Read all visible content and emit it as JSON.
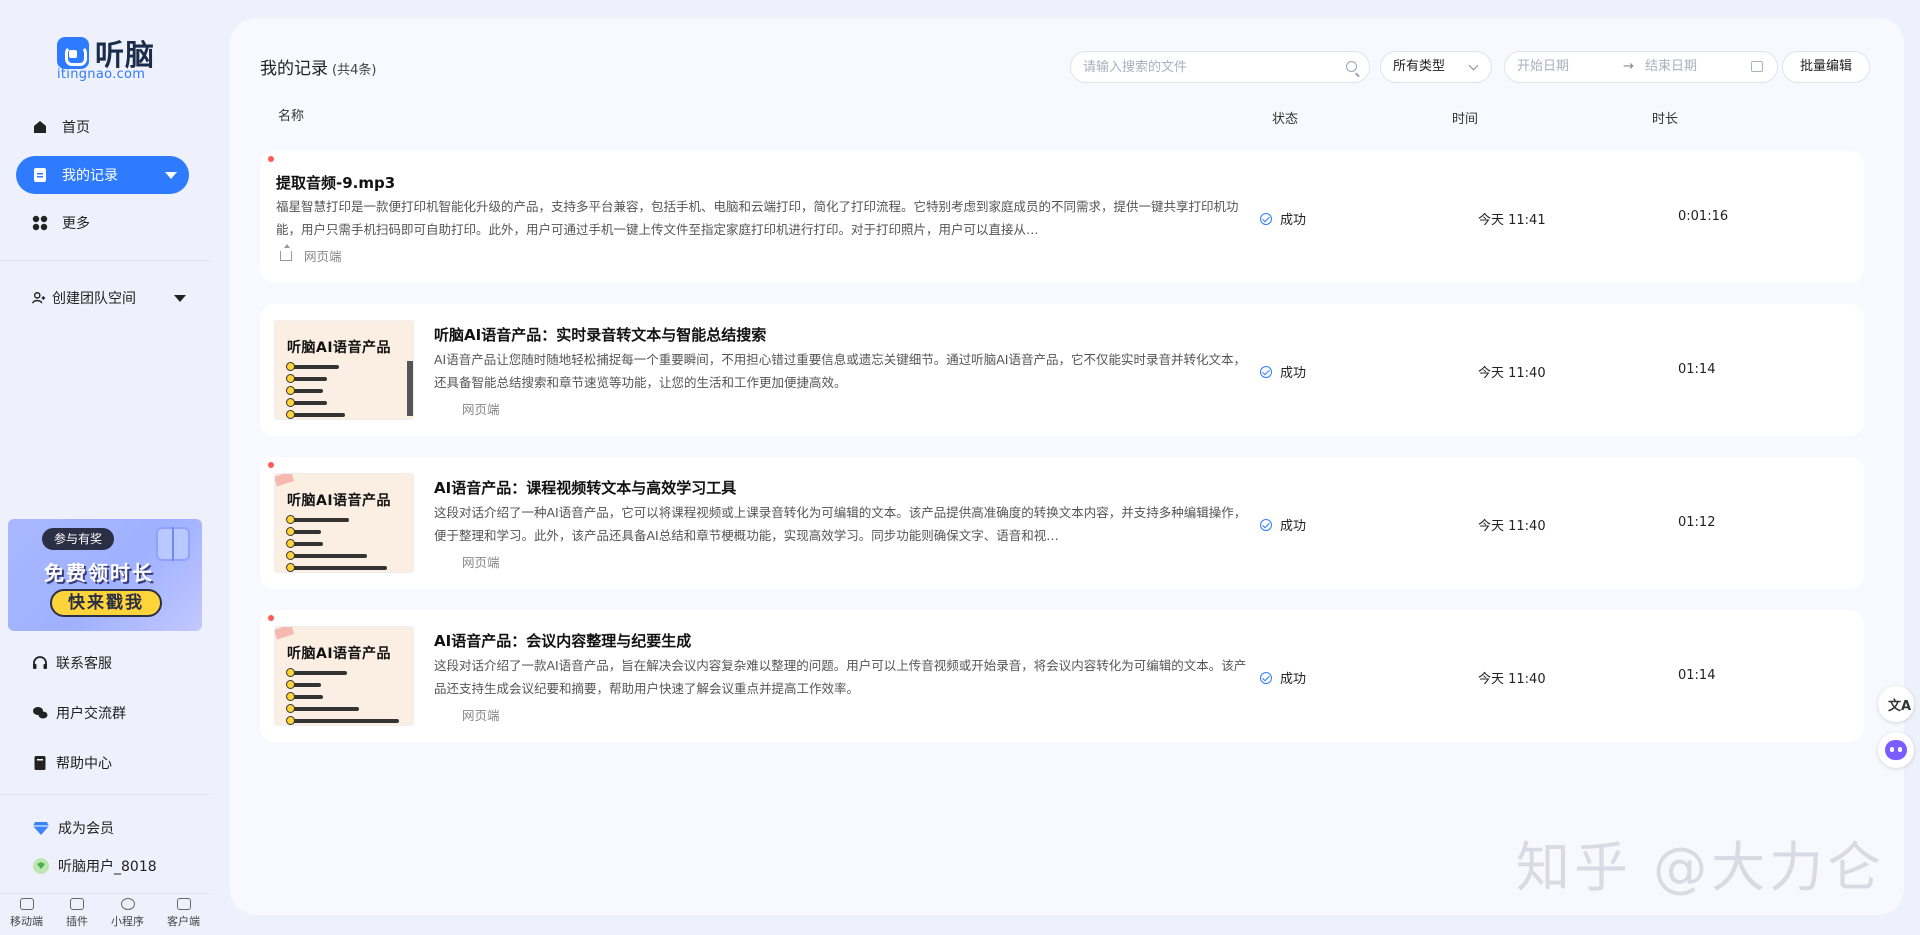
{
  "brand": {
    "name": "听脑",
    "url": "itingnao.com"
  },
  "nav": {
    "home": "首页",
    "records": "我的记录",
    "more": "更多",
    "team": "创建团队空间"
  },
  "promo": {
    "tag": "参与有奖",
    "headline": "免费领时长",
    "cta": "快来戳我"
  },
  "side_links": {
    "support": "联系客服",
    "community": "用户交流群",
    "help": "帮助中心",
    "vip": "成为会员",
    "user": "听脑用户_8018"
  },
  "bottom_bar": [
    "移动端",
    "插件",
    "小程序",
    "客户端"
  ],
  "header": {
    "title": "我的记录",
    "count": "(共4条)",
    "search_placeholder": "请输入搜索的文件",
    "type_filter": "所有类型",
    "date_start": "开始日期",
    "date_arrow": "→",
    "date_end": "结束日期",
    "batch_edit": "批量编辑"
  },
  "columns": {
    "name": "名称",
    "status": "状态",
    "time": "时间",
    "duration": "时长"
  },
  "records": [
    {
      "name": "提取音频-9.mp3",
      "desc": "福星智慧打印是一款便打印机智能化升级的产品，支持多平台兼容，包括手机、电脑和云端打印，简化了打印流程。它特别考虑到家庭成员的不同需求，提供一键共享打印机功能，用户只需手机扫码即可自助打印。此外，用户可通过手机一键上传文件至指定家庭打印机进行打印。对于打印照片，用户可以直接从…",
      "source": "网页端",
      "status": "成功",
      "time": "今天 11:41",
      "duration": "0:01:16",
      "has_thumb": false,
      "unread": true
    },
    {
      "name": "听脑AI语音产品：实时录音转文本与智能总结搜索",
      "desc": "AI语音产品让您随时随地轻松捕捉每一个重要瞬间，不用担心错过重要信息或遗忘关键细节。通过听脑AI语音产品，它不仅能实时录音并转化文本，还具备智能总结搜索和章节速览等功能，让您的生活和工作更加便捷高效。",
      "source": "网页端",
      "status": "成功",
      "time": "今天 11:40",
      "duration": "01:14",
      "has_thumb": true,
      "unread": false
    },
    {
      "name": "AI语音产品：课程视频转文本与高效学习工具",
      "desc": "这段对话介绍了一种AI语音产品，它可以将课程视频或上课录音转化为可编辑的文本。该产品提供高准确度的转换文本内容，并支持多种编辑操作，便于整理和学习。此外，该产品还具备AI总结和章节梗概功能，实现高效学习。同步功能则确保文字、语音和视…",
      "source": "网页端",
      "status": "成功",
      "time": "今天 11:40",
      "duration": "01:12",
      "has_thumb": true,
      "unread": true
    },
    {
      "name": "AI语音产品：会议内容整理与纪要生成",
      "desc": "这段对话介绍了一款AI语音产品，旨在解决会议内容复杂难以整理的问题。用户可以上传音视频或开始录音，将会议内容转化为可编辑的文本。该产品还支持生成会议纪要和摘要，帮助用户快速了解会议重点并提高工作效率。",
      "source": "网页端",
      "status": "成功",
      "time": "今天 11:40",
      "duration": "01:14",
      "has_thumb": true,
      "unread": true
    }
  ],
  "thumb_text": "听脑AI语音产品",
  "watermark": "知乎 @大力仑",
  "float": {
    "translate_icon": "文A"
  }
}
